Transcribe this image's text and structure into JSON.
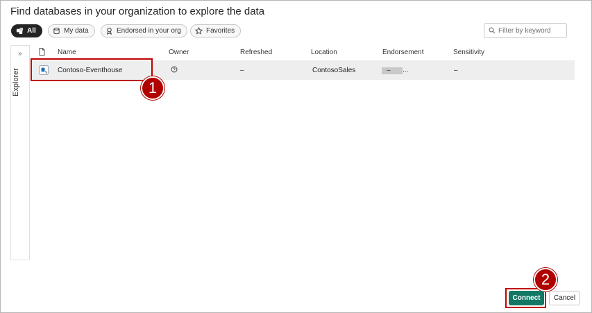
{
  "dialog": {
    "title": "Find databases in your organization to explore the data"
  },
  "filters": {
    "chips": [
      {
        "label": "All",
        "icon": "cube-stack-icon",
        "active": true
      },
      {
        "label": "My data",
        "icon": "database-icon",
        "active": false
      },
      {
        "label": "Endorsed in your org",
        "icon": "ribbon-icon",
        "active": false
      },
      {
        "label": "Favorites",
        "icon": "star-icon",
        "active": false
      }
    ],
    "search_placeholder": "Filter by keyword"
  },
  "explorer": {
    "label": "Explorer",
    "chevron": "»"
  },
  "table": {
    "columns": [
      "Name",
      "Owner",
      "Refreshed",
      "Location",
      "Endorsement",
      "Sensitivity"
    ],
    "rows": [
      {
        "name": "Contoso-Eventhouse",
        "refreshed": "–",
        "location": "ContosoSales",
        "location_suffix": "...",
        "endorsement": "–",
        "sensitivity": "–"
      }
    ]
  },
  "annotations": {
    "step1": "1",
    "step2": "2",
    "color": "#b00000"
  },
  "footer": {
    "connect_label": "Connect",
    "cancel_label": "Cancel",
    "accent": "#117865"
  }
}
